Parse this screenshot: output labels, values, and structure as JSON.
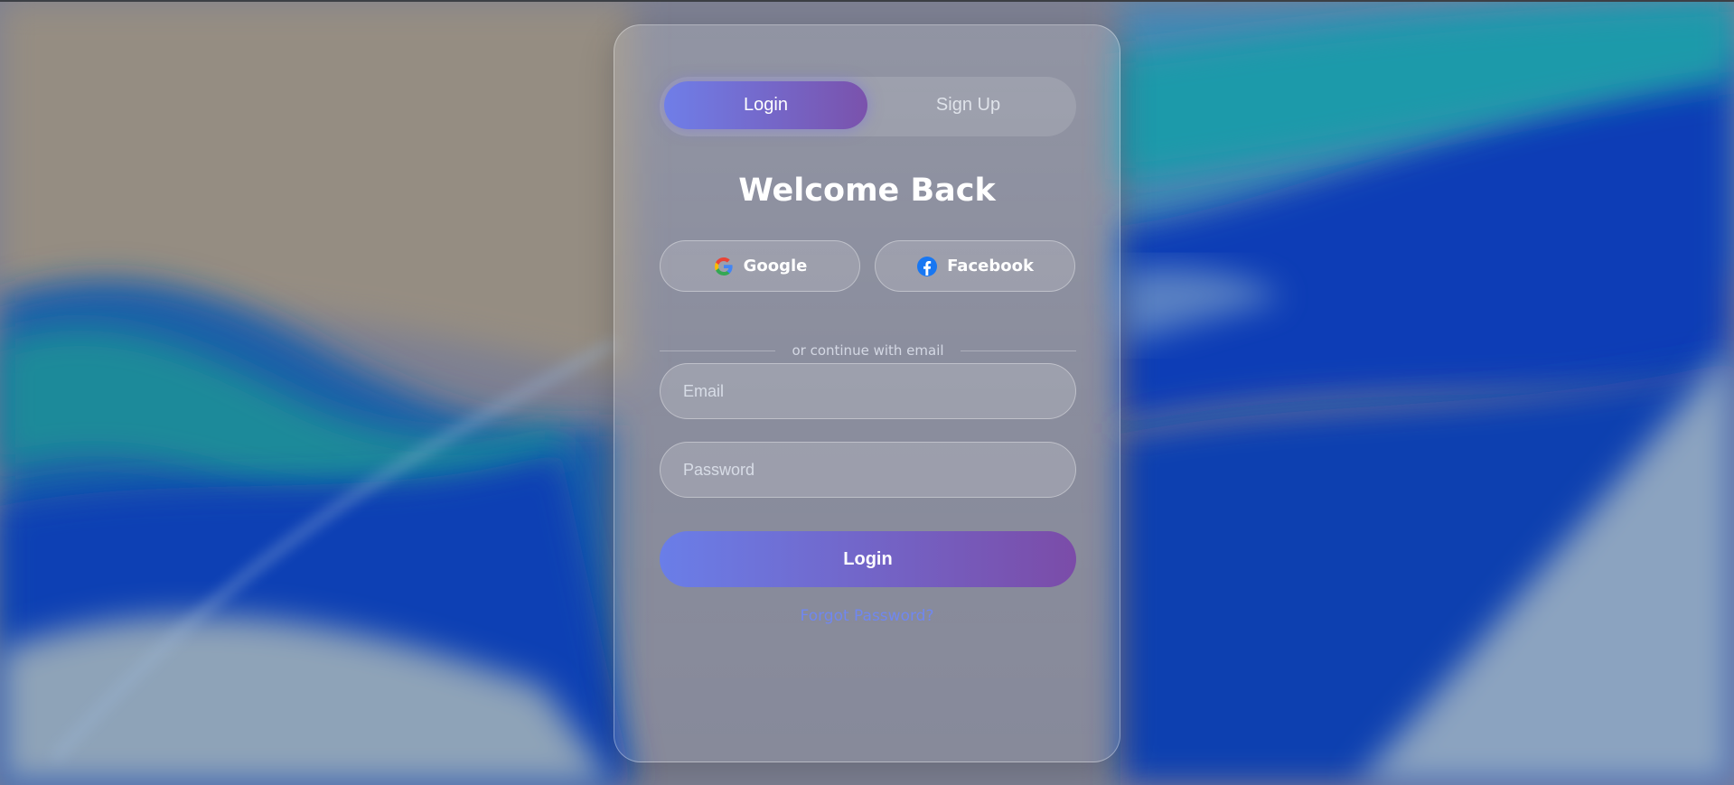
{
  "auth": {
    "tabs": [
      {
        "label": "Login",
        "active": true
      },
      {
        "label": "Sign Up",
        "active": false
      }
    ],
    "title": "Welcome Back",
    "social": {
      "google_label": "Google",
      "facebook_label": "Facebook"
    },
    "divider_text": "or continue with email",
    "email": {
      "placeholder": "Email",
      "value": ""
    },
    "password": {
      "placeholder": "Password",
      "value": ""
    },
    "submit_label": "Login",
    "forgot_label": "Forgot Password?"
  },
  "colors": {
    "accent_start": "#6f7ee8",
    "accent_end": "#7a52ac",
    "link": "#7087f0",
    "facebook_blue": "#1877f2"
  },
  "icons": [
    "google-icon",
    "facebook-icon"
  ]
}
